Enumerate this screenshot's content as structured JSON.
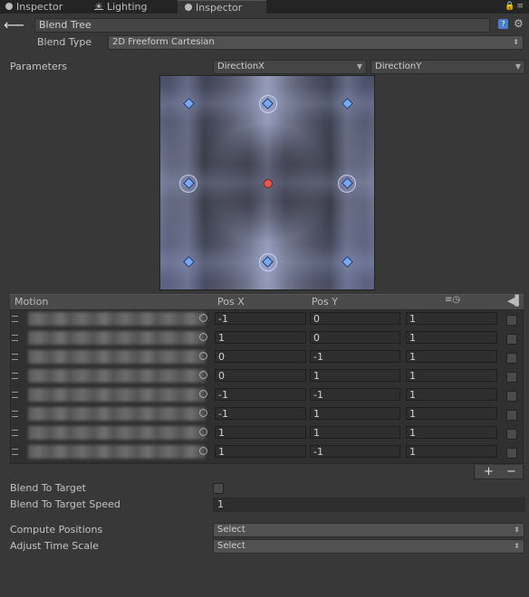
{
  "tabs": [
    {
      "label": "Inspector",
      "active": false
    },
    {
      "label": "Lighting",
      "active": false
    },
    {
      "label": "Inspector",
      "active": true
    }
  ],
  "header": {
    "name_value": "Blend Tree",
    "blend_type_label": "Blend Type",
    "blend_type_value": "2D Freeform Cartesian"
  },
  "parameters": {
    "label": "Parameters",
    "param_x": "DirectionX",
    "param_y": "DirectionY"
  },
  "motion_list": {
    "headers": {
      "motion": "Motion",
      "pos_x": "Pos X",
      "pos_y": "Pos Y"
    },
    "rows": [
      {
        "pos_x": "-1",
        "pos_y": "0",
        "speed": "1"
      },
      {
        "pos_x": "1",
        "pos_y": "0",
        "speed": "1"
      },
      {
        "pos_x": "0",
        "pos_y": "-1",
        "speed": "1"
      },
      {
        "pos_x": "0",
        "pos_y": "1",
        "speed": "1"
      },
      {
        "pos_x": "-1",
        "pos_y": "-1",
        "speed": "1"
      },
      {
        "pos_x": "-1",
        "pos_y": "1",
        "speed": "1"
      },
      {
        "pos_x": "1",
        "pos_y": "1",
        "speed": "1"
      },
      {
        "pos_x": "1",
        "pos_y": "-1",
        "speed": "1"
      }
    ],
    "add_label": "+",
    "remove_label": "−"
  },
  "properties": {
    "blend_to_target": "Blend To Target",
    "blend_to_target_speed": "Blend To Target Speed",
    "blend_to_target_speed_value": "1",
    "compute_positions": "Compute Positions",
    "compute_positions_value": "Select",
    "adjust_time_scale": "Adjust Time Scale",
    "adjust_time_scale_value": "Select"
  },
  "icons": {
    "back": "back-arrow-icon",
    "help": "help-icon",
    "settings": "gear-icon",
    "lock": "lock-icon",
    "menu": "menu-icon",
    "time_scale": "clock-icon",
    "mirror": "mirror-icon"
  },
  "colors": {
    "panel_bg": "#383838",
    "motion_point": "#7aa7ee",
    "parameter_point": "#e05a55",
    "help_icon": "#4a7ec9"
  }
}
